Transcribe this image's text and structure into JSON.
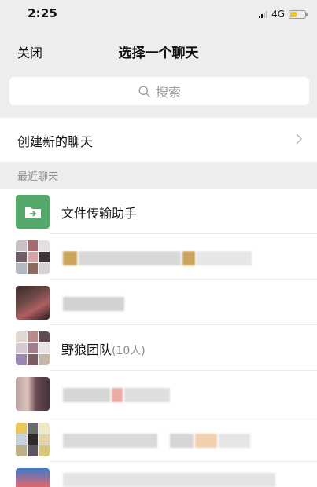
{
  "status_bar": {
    "time": "2:25",
    "network": "4G"
  },
  "nav": {
    "close_label": "关闭",
    "title": "选择一个聊天"
  },
  "search": {
    "placeholder": "搜索"
  },
  "new_chat": {
    "label": "创建新的聊天"
  },
  "section": {
    "recent_label": "最近聊天"
  },
  "chats": [
    {
      "name": "文件传输助手",
      "icon": "file-transfer-icon",
      "color": "#53a86a"
    },
    {
      "name": "",
      "blurred": true
    },
    {
      "name": "",
      "blurred": true
    },
    {
      "name": "野狼团队",
      "count": "(10人)"
    },
    {
      "name": "",
      "blurred": true
    },
    {
      "name": "",
      "blurred": true
    }
  ]
}
